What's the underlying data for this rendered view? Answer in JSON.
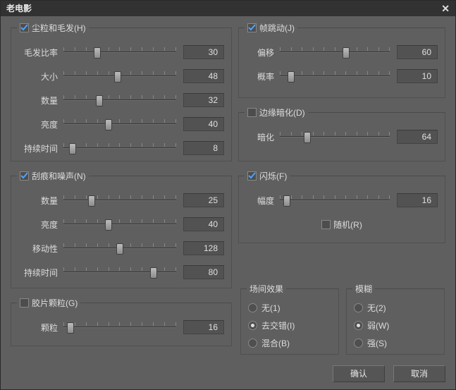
{
  "title": "老电影",
  "groups": {
    "dust": {
      "title": "尘粒和毛发(H)",
      "checked": true
    },
    "scratch": {
      "title": "刮痕和噪声(N)",
      "checked": true
    },
    "grain": {
      "title": "胶片颗粒(G)",
      "checked": false
    },
    "jitter": {
      "title": "帧跳动(J)",
      "checked": true
    },
    "vignette": {
      "title": "边缘暗化(D)",
      "checked": false
    },
    "flicker": {
      "title": "闪烁(F)",
      "checked": true
    },
    "field": {
      "title": "场间效果"
    },
    "blur": {
      "title": "模糊"
    }
  },
  "sliders": {
    "dust_ratio": {
      "label": "毛发比率",
      "value": 30,
      "max": 100
    },
    "dust_size": {
      "label": "大小",
      "value": 48,
      "max": 100
    },
    "dust_count": {
      "label": "数量",
      "value": 32,
      "max": 100
    },
    "dust_bright": {
      "label": "亮度",
      "value": 40,
      "max": 100
    },
    "dust_duration": {
      "label": "持续时间",
      "value": 8,
      "max": 100
    },
    "scratch_count": {
      "label": "数量",
      "value": 25,
      "max": 100
    },
    "scratch_bright": {
      "label": "亮度",
      "value": 40,
      "max": 100
    },
    "scratch_move": {
      "label": "移动性",
      "value": 128,
      "max": 256
    },
    "scratch_dur": {
      "label": "持续时间",
      "value": 80,
      "max": 100
    },
    "grain_amount": {
      "label": "颗粒",
      "value": 16,
      "max": 256
    },
    "jitter_offset": {
      "label": "偏移",
      "value": 60,
      "max": 100
    },
    "jitter_prob": {
      "label": "概率",
      "value": 10,
      "max": 100
    },
    "vignette_dark": {
      "label": "暗化",
      "value": 64,
      "max": 256
    },
    "flicker_amp": {
      "label": "幅度",
      "value": 16,
      "max": 256
    }
  },
  "flicker_random": {
    "label": "随机(R)",
    "checked": false
  },
  "field_options": [
    {
      "label": "无(1)",
      "selected": false
    },
    {
      "label": "去交错(I)",
      "selected": true
    },
    {
      "label": "混合(B)",
      "selected": false
    }
  ],
  "blur_options": [
    {
      "label": "无(2)",
      "selected": false
    },
    {
      "label": "弱(W)",
      "selected": true
    },
    {
      "label": "强(S)",
      "selected": false
    }
  ],
  "buttons": {
    "ok": "确认",
    "cancel": "取消"
  }
}
